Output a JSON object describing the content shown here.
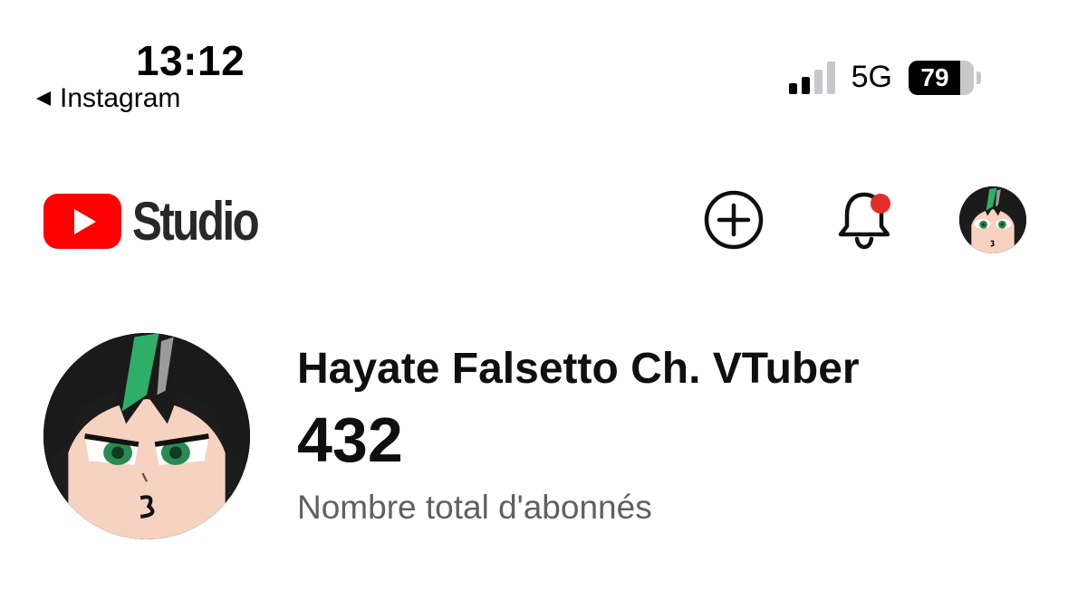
{
  "status_bar": {
    "time": "13:12",
    "back_app": "Instagram",
    "network": "5G",
    "signal_bars_active": 2,
    "signal_bars_total": 4,
    "battery_percent": "79",
    "battery_level": 0.79
  },
  "header": {
    "logo_text": "Studio",
    "brand_color": "#ff0000",
    "icons": [
      "youtube-play-icon",
      "create-plus-icon",
      "bell-icon",
      "avatar"
    ],
    "notification_dot_color": "#e52d27"
  },
  "channel": {
    "name": "Hayate Falsetto Ch. VTuber",
    "subscriber_count": "432",
    "subscriber_label": "Nombre total d'abonnés"
  }
}
